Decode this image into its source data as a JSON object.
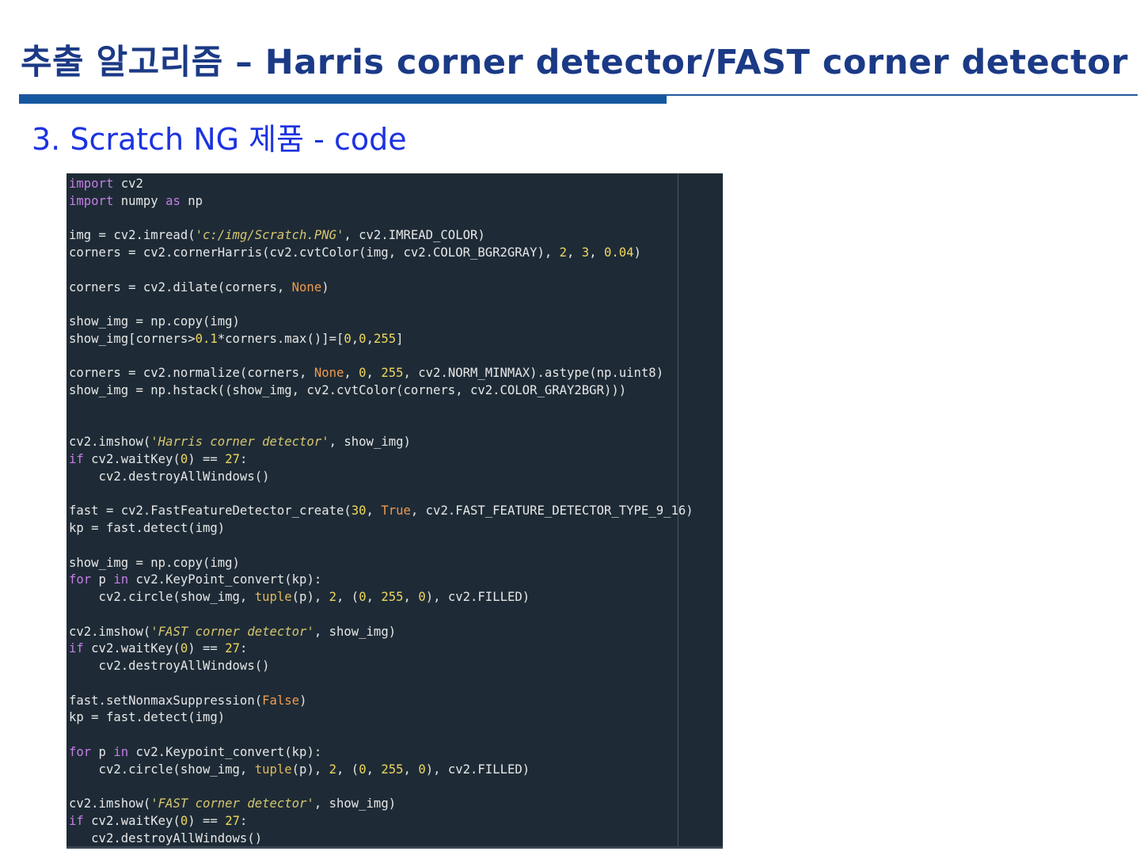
{
  "slide": {
    "title": "추출 알고리즘 – Harris corner detector/FAST corner detector",
    "subtitle": "3. Scratch NG 제품 - code"
  },
  "colors": {
    "title": "#1b3a86",
    "subtitle": "#1c33e0",
    "rule": "#15579f",
    "code_background": "#1e2b36"
  },
  "code": {
    "language": "python",
    "lines": [
      "import cv2",
      "import numpy as np",
      "",
      "img = cv2.imread('c:/img/Scratch.PNG', cv2.IMREAD_COLOR)",
      "corners = cv2.cornerHarris(cv2.cvtColor(img, cv2.COLOR_BGR2GRAY), 2, 3, 0.04)",
      "",
      "corners = cv2.dilate(corners, None)",
      "",
      "show_img = np.copy(img)",
      "show_img[corners>0.1*corners.max()]=[0,0,255]",
      "",
      "corners = cv2.normalize(corners, None, 0, 255, cv2.NORM_MINMAX).astype(np.uint8)",
      "show_img = np.hstack((show_img, cv2.cvtColor(corners, cv2.COLOR_GRAY2BGR)))",
      "",
      "",
      "cv2.imshow('Harris corner detector', show_img)",
      "if cv2.waitKey(0) == 27:",
      "    cv2.destroyAllWindows()",
      "",
      "fast = cv2.FastFeatureDetector_create(30, True, cv2.FAST_FEATURE_DETECTOR_TYPE_9_16)",
      "kp = fast.detect(img)",
      "",
      "show_img = np.copy(img)",
      "for p in cv2.KeyPoint_convert(kp):",
      "    cv2.circle(show_img, tuple(p), 2, (0, 255, 0), cv2.FILLED)",
      "",
      "cv2.imshow('FAST corner detector', show_img)",
      "if cv2.waitKey(0) == 27:",
      "    cv2.destroyAllWindows()",
      "",
      "fast.setNonmaxSuppression(False)",
      "kp = fast.detect(img)",
      "",
      "for p in cv2.Keypoint_convert(kp):",
      "    cv2.circle(show_img, tuple(p), 2, (0, 255, 0), cv2.FILLED)",
      "",
      "cv2.imshow('FAST corner detector', show_img)",
      "if cv2.waitKey(0) == 27:",
      "   cv2.destroyAllWindows()"
    ]
  }
}
